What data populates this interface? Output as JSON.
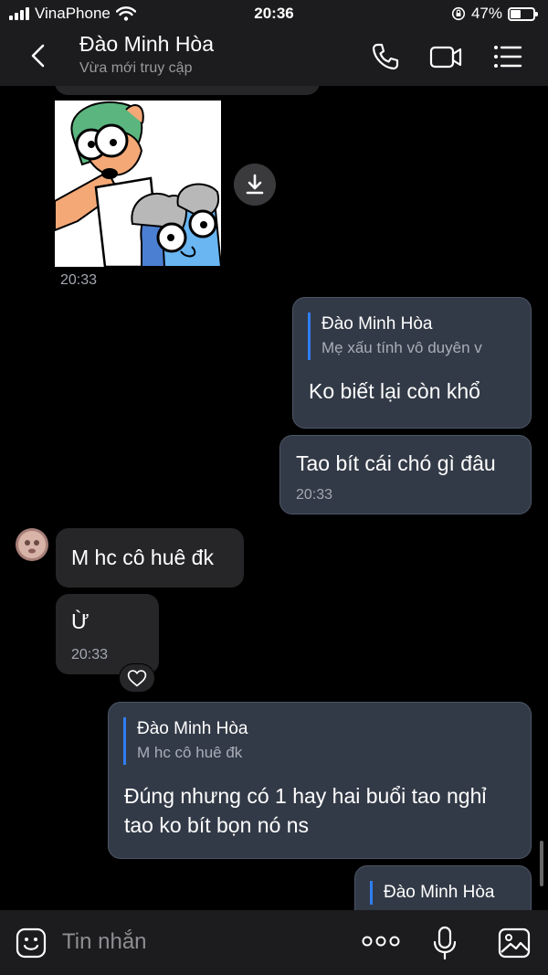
{
  "status_bar": {
    "carrier": "VinaPhone",
    "time": "20:36",
    "battery": "47%",
    "battery_level": 0.47
  },
  "header": {
    "title": "Đào Minh Hòa",
    "subtitle": "Vừa mới truy cập"
  },
  "messages": {
    "sticker_time": "20:33",
    "out1": {
      "reply_name": "Đào Minh Hòa",
      "reply_text": "Mẹ xấu tính vô duyên v",
      "text": "Ko biết lại còn khổ"
    },
    "out2": {
      "text": "Tao bít cái chó gì đâu",
      "time": "20:33"
    },
    "in1": {
      "text": "M hc cô huê đk"
    },
    "in2": {
      "text": "Ừ",
      "time": "20:33"
    },
    "out3": {
      "reply_name": "Đào Minh Hòa",
      "reply_text": "M hc cô huê đk",
      "line1": "Đúng nhưng có 1 hay hai buổi tao nghỉ",
      "line2": "tao ko bít bọn nó ns"
    },
    "out4": {
      "reply_name": "Đào Minh Hòa"
    }
  },
  "input": {
    "placeholder": "Tin nhắn"
  },
  "colors": {
    "background": "#000000",
    "bar": "#1c1c1e",
    "incoming_bubble": "#262629",
    "outgoing_bubble": "#333a47",
    "reply_accent": "#2f7ef1"
  }
}
